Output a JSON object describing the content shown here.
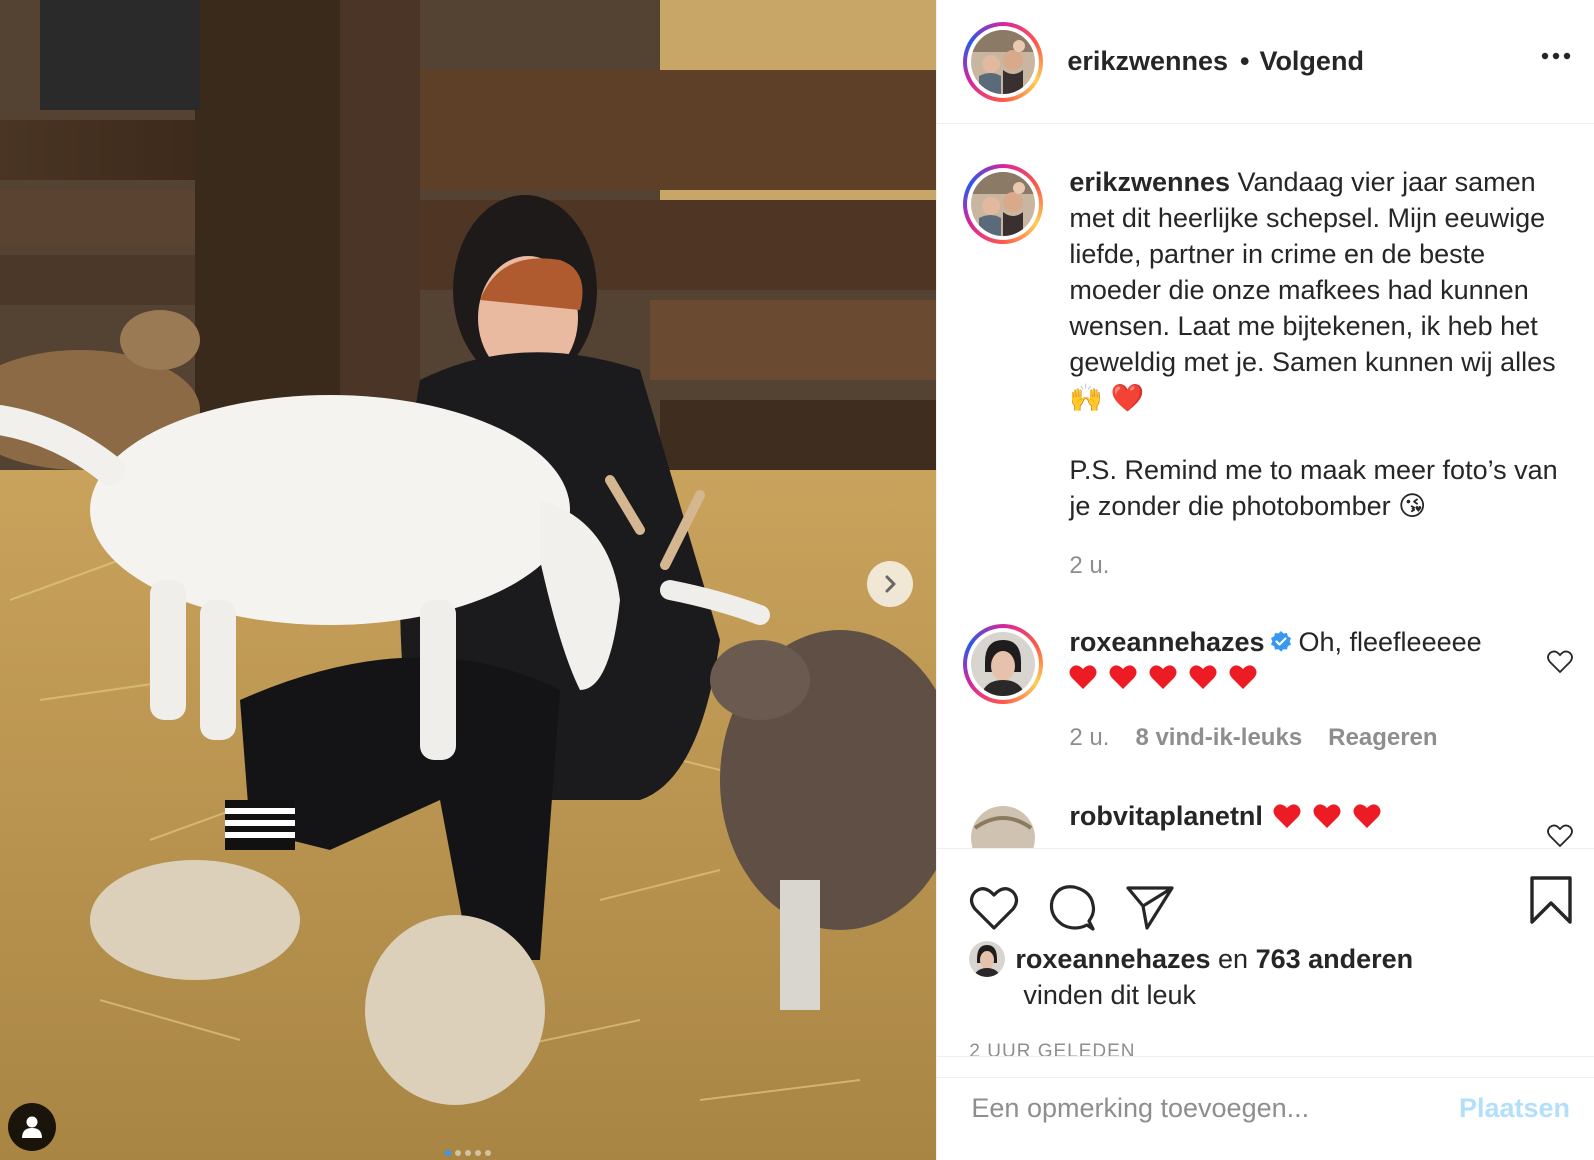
{
  "post": {
    "author": "erikzwennes",
    "separator": "•",
    "follow_status": "Volgend",
    "more_label": "...",
    "image_alt": "",
    "carousel": {
      "count": 5,
      "active": 0
    }
  },
  "caption": {
    "username": "erikzwennes",
    "text": "Vandaag vier jaar samen met dit heerlijke schepsel. Mijn eeuwige liefde, partner in crime en de beste moeder die onze mafkees had kunnen wensen. Laat me bijtekenen, ik heb het geweldig met je. Samen kunnen wij alles 🙌 ❤️",
    "ps": "P.S. Remind me to maak meer foto’s van je zonder die photobomber 😘",
    "age": "2 u."
  },
  "comments": [
    {
      "username": "roxeannehazes",
      "verified": true,
      "text": "Oh, fleefleeeee",
      "hearts": 5,
      "age": "2 u.",
      "likes": "8 vind-ik-leuks",
      "reply": "Reageren"
    },
    {
      "username": "robvitaplanetnl",
      "verified": false,
      "hearts": 3
    }
  ],
  "likes": {
    "first_user": "roxeannehazes",
    "conjunction": "en",
    "others": "763 anderen",
    "suffix": "vinden dit leuk"
  },
  "timestamp": "2 UUR GELEDEN",
  "add_comment": {
    "placeholder": "Een opmerking toevoegen...",
    "post_label": "Plaatsen"
  },
  "colors": {
    "text": "#262626",
    "muted": "#8e8e8e",
    "heart_red": "#ed4956",
    "verified_blue": "#3897f0",
    "post_disabled": "#b2dffc"
  }
}
